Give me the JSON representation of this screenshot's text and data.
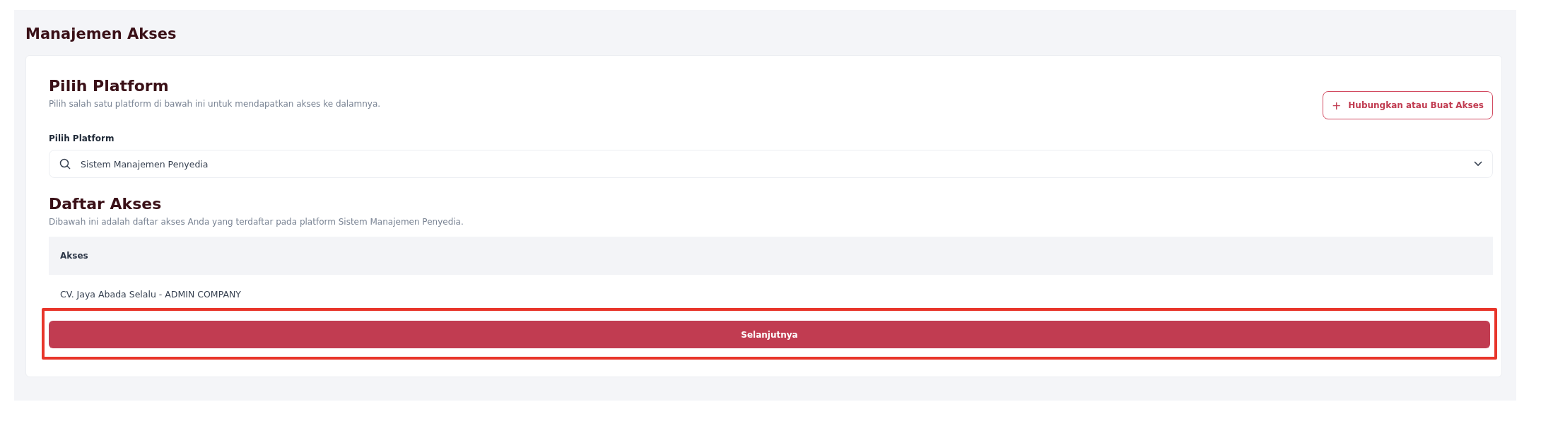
{
  "page": {
    "title": "Manajemen Akses"
  },
  "platform_section": {
    "title": "Pilih Platform",
    "description": "Pilih salah satu platform di bawah ini untuk mendapatkan akses ke dalamnya.",
    "action_button": {
      "icon": "+",
      "label": "Hubungkan atau Buat Akses"
    },
    "field_label": "Pilih Platform",
    "select_value": "Sistem Manajemen Penyedia"
  },
  "access_section": {
    "title": "Daftar Akses",
    "description": "Dibawah ini adalah daftar akses Anda yang terdaftar pada platform Sistem Manajemen Penyedia.",
    "table": {
      "columns": [
        "Akses"
      ],
      "rows": [
        [
          "CV. Jaya Abada Selalu - ADMIN COMPANY"
        ]
      ]
    }
  },
  "next_button": {
    "label": "Selanjutnya",
    "highlighted": true
  }
}
